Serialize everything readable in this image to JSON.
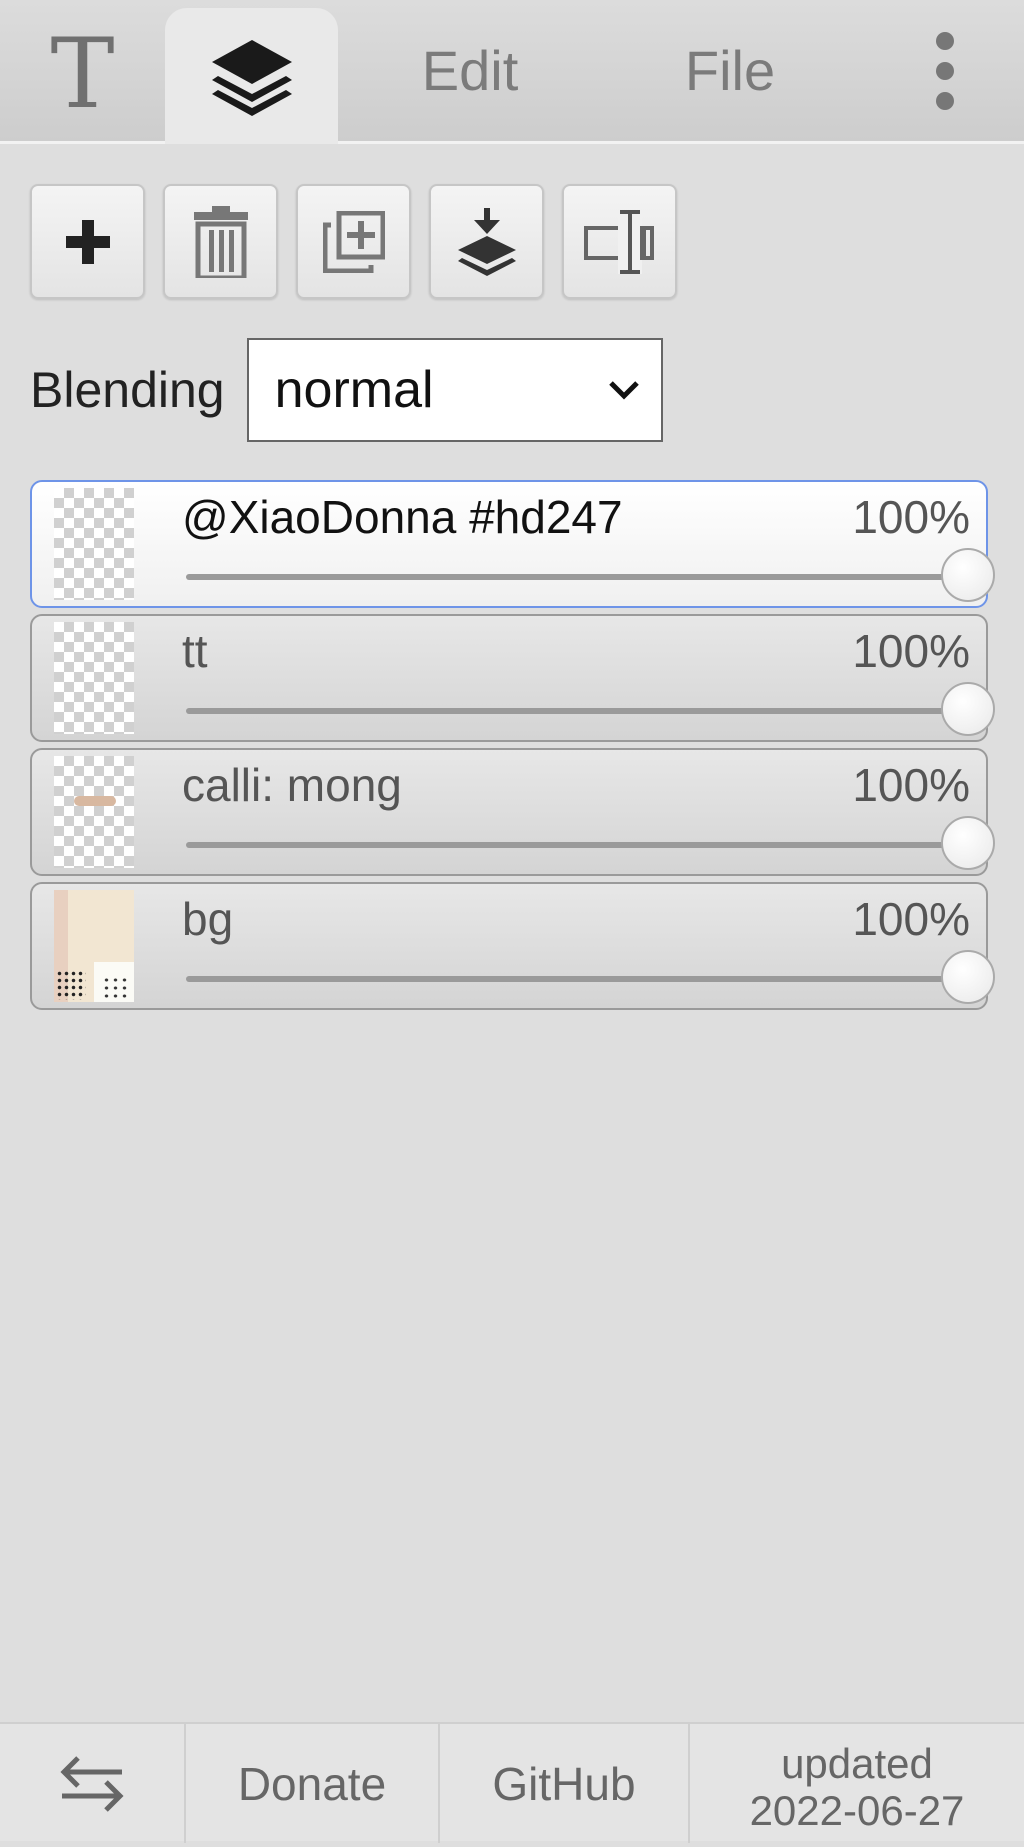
{
  "tabs": {
    "text_tab_glyph": "T",
    "layers_tab_icon": "layers-icon",
    "edit": "Edit",
    "file": "File",
    "more_icon": "more-vertical-icon"
  },
  "toolbar": {
    "buttons": [
      {
        "icon": "plus-icon",
        "label": "Add layer"
      },
      {
        "icon": "trash-icon",
        "label": "Delete layer"
      },
      {
        "icon": "duplicate-icon",
        "label": "Duplicate layer"
      },
      {
        "icon": "merge-down-icon",
        "label": "Merge down"
      },
      {
        "icon": "rename-icon",
        "label": "Rename layer"
      }
    ]
  },
  "blending": {
    "label": "Blending",
    "selected": "normal"
  },
  "layers": [
    {
      "name": "@XiaoDonna #hd247",
      "opacity_text": "100%",
      "opacity": 1.0,
      "active": true
    },
    {
      "name": "tt",
      "opacity_text": "100%",
      "opacity": 1.0,
      "active": false
    },
    {
      "name": "calli: mong",
      "opacity_text": "100%",
      "opacity": 1.0,
      "active": false
    },
    {
      "name": "bg",
      "opacity_text": "100%",
      "opacity": 1.0,
      "active": false
    }
  ],
  "footer": {
    "swap_icon": "swap-arrows-icon",
    "donate": "Donate",
    "github": "GitHub",
    "updated_line1": "updated",
    "updated_line2": "2022-06-27"
  },
  "colors": {
    "active_border": "#6e94e8",
    "background": "#dedede"
  }
}
